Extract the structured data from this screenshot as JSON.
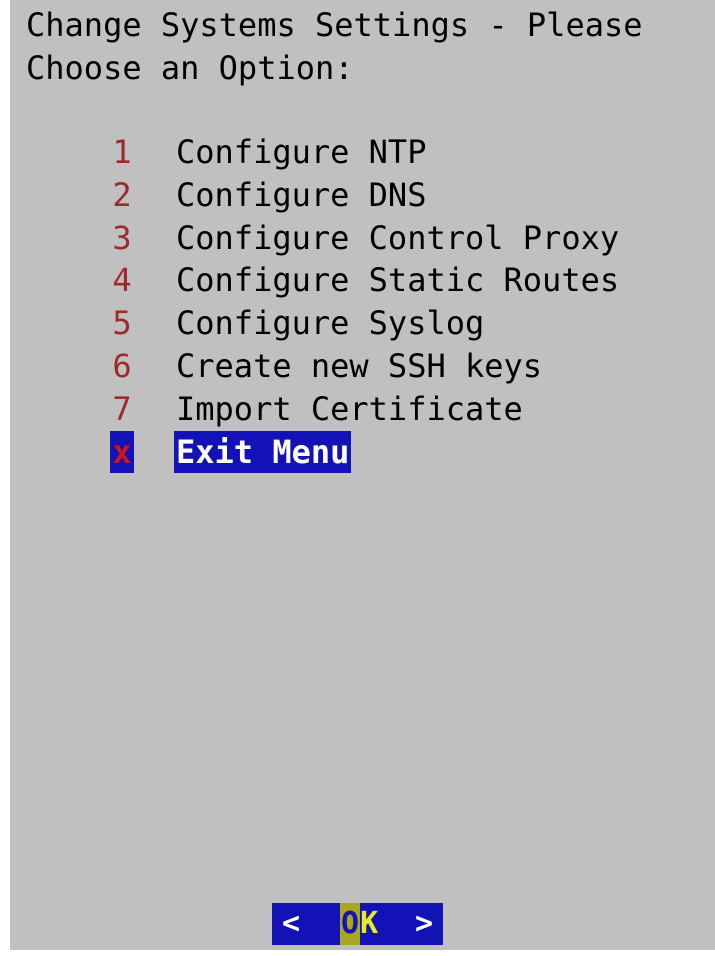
{
  "dialog": {
    "prompt_line1": "Change Systems Settings - Please",
    "prompt_line2": "Choose an Option:",
    "menu_items": [
      {
        "key": "1",
        "label": "Configure NTP"
      },
      {
        "key": "2",
        "label": "Configure DNS"
      },
      {
        "key": "3",
        "label": "Configure Control Proxy"
      },
      {
        "key": "4",
        "label": "Configure Static Routes"
      },
      {
        "key": "5",
        "label": "Configure Syslog"
      },
      {
        "key": "6",
        "label": "Create new SSH keys"
      },
      {
        "key": "7",
        "label": "Import Certificate"
      },
      {
        "key": "x",
        "label": "Exit Menu"
      }
    ],
    "selected_index": 7
  },
  "buttons": {
    "left_bracket": "<",
    "ok_hotkey": "O",
    "ok_rest": "K",
    "right_bracket": ">"
  },
  "colors": {
    "background": "#c0c0c0",
    "menu_key": "#9e2a2a",
    "selection": "#1212b6",
    "button_text": "#e8e826"
  }
}
